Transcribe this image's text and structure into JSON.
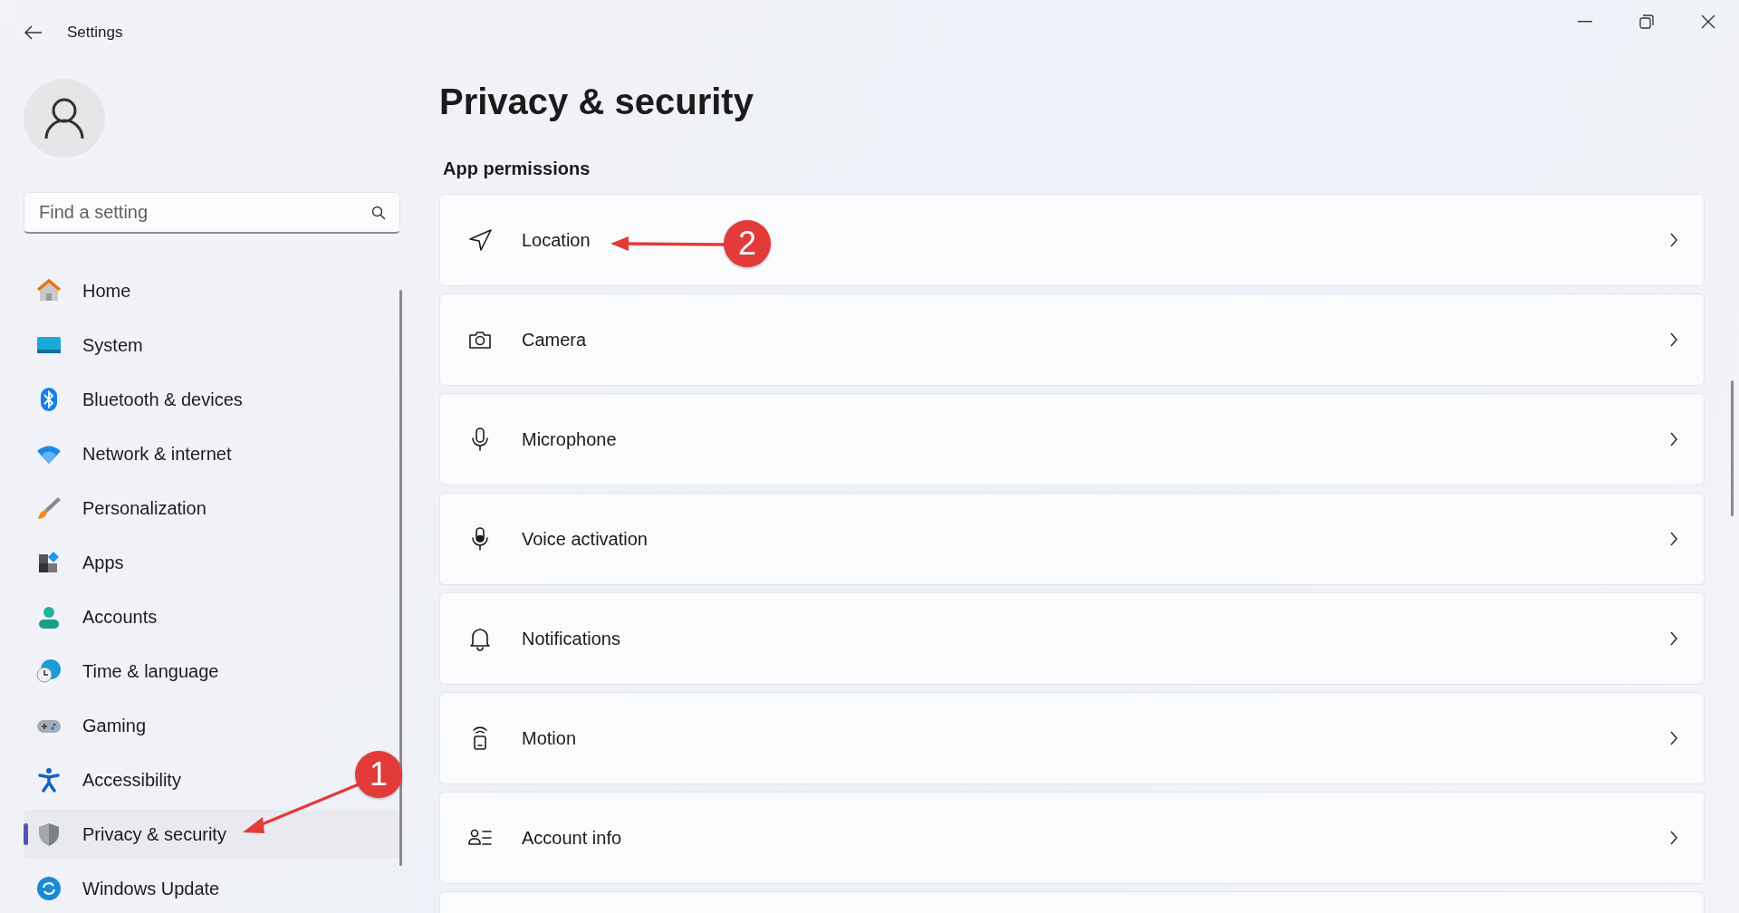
{
  "window": {
    "title": "Settings"
  },
  "search": {
    "placeholder": "Find a setting"
  },
  "sidebar": {
    "items": [
      {
        "label": "Home",
        "selected": false
      },
      {
        "label": "System",
        "selected": false
      },
      {
        "label": "Bluetooth & devices",
        "selected": false
      },
      {
        "label": "Network & internet",
        "selected": false
      },
      {
        "label": "Personalization",
        "selected": false
      },
      {
        "label": "Apps",
        "selected": false
      },
      {
        "label": "Accounts",
        "selected": false
      },
      {
        "label": "Time & language",
        "selected": false
      },
      {
        "label": "Gaming",
        "selected": false
      },
      {
        "label": "Accessibility",
        "selected": false
      },
      {
        "label": "Privacy & security",
        "selected": true
      },
      {
        "label": "Windows Update",
        "selected": false
      }
    ]
  },
  "page": {
    "title": "Privacy & security",
    "section": "App permissions"
  },
  "cards": [
    {
      "kind": "row",
      "label": "Location"
    },
    {
      "kind": "row",
      "label": "Camera"
    },
    {
      "kind": "row",
      "label": "Microphone"
    },
    {
      "kind": "row",
      "label": "Voice activation"
    },
    {
      "kind": "row",
      "label": "Notifications"
    },
    {
      "kind": "row",
      "label": "Motion"
    },
    {
      "kind": "row",
      "label": "Account info"
    },
    {
      "kind": "partial"
    }
  ],
  "annotations": [
    {
      "number": "1"
    },
    {
      "number": "2"
    }
  ]
}
